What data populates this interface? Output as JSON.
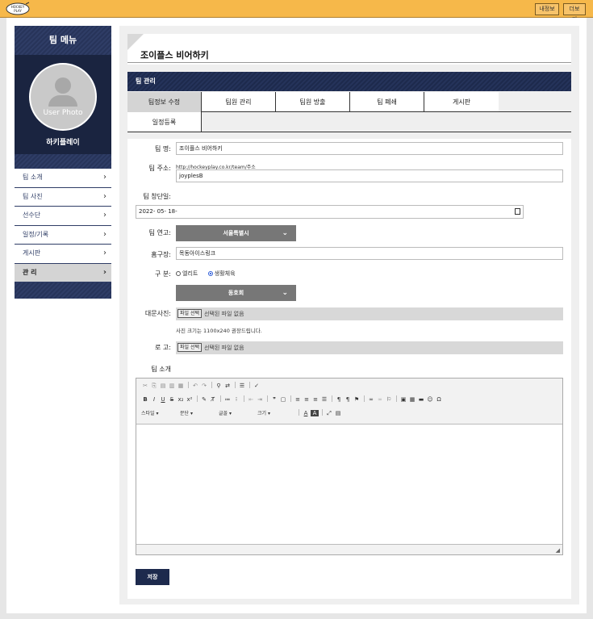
{
  "topbar": {
    "logo_text": "HOCKEY PLAY",
    "mypage_label": "내정보",
    "more_label": "더보기"
  },
  "sidebar": {
    "title": "팀 메뉴",
    "photo_placeholder": "User Photo",
    "team_nickname": "하키플레이",
    "items": [
      {
        "label": "팀 소개"
      },
      {
        "label": "팀 사진"
      },
      {
        "label": "선수단"
      },
      {
        "label": "일정/기록"
      },
      {
        "label": "게시판"
      },
      {
        "label": "관 리"
      }
    ],
    "active_item": "관 리"
  },
  "main": {
    "page_title": "조이플스 비어하키",
    "section_title": "팀 관리",
    "tabs": [
      {
        "label": "팀정보 수정"
      },
      {
        "label": "팀원 관리"
      },
      {
        "label": "팀원 방출"
      },
      {
        "label": "팀 폐쇄"
      },
      {
        "label": "게시판"
      },
      {
        "label": "일정등록"
      }
    ],
    "active_tab": "팀정보 수정"
  },
  "form": {
    "team_name_label": "팀 명:",
    "team_name_value": "조이플스 비어하키",
    "team_url_label": "팀 주소:",
    "team_url_prefix": "http://hockeyplay.co.kr/team/주소",
    "team_url_value": "joyplesB",
    "founded_label": "팀 창단일:",
    "founded_value": "2022- 05- 18-",
    "region_label": "팀 연고:",
    "region_value": "서울특별시",
    "home_rink_label": "홈구장:",
    "home_rink_value": "목동아이스링크",
    "category_label": "구 분:",
    "category_options": [
      {
        "label": "엘리트",
        "selected": false
      },
      {
        "label": "생활체육",
        "selected": true
      }
    ],
    "level_value": "동호회",
    "banner_label": "대문사진:",
    "file_button_label": "파일 선택",
    "no_file_text": "선택된 파일 없음",
    "banner_hint": "사진 크기는 1100x240 권장드립니다.",
    "logo_label": "로 고:",
    "intro_label": "팀 소개",
    "save_label": "저장"
  },
  "editor": {
    "style_combo": "스타일",
    "paragraph_combo": "문단",
    "font_combo": "글꼴",
    "size_combo": "크기",
    "toolbar_row1": [
      "cut-icon",
      "copy-icon",
      "paste-icon",
      "paste-text-icon",
      "paste-word-icon",
      "undo-icon",
      "redo-icon",
      "find-icon",
      "replace-icon",
      "select-all-icon",
      "spellcheck-icon"
    ],
    "toolbar_row2": [
      "bold-icon",
      "italic-icon",
      "underline-icon",
      "strike-icon",
      "subscript-icon",
      "superscript-icon",
      "copy-format-icon",
      "remove-format-icon",
      "numbered-list-icon",
      "bullet-list-icon",
      "outdent-icon",
      "indent-icon",
      "blockquote-icon",
      "div-icon",
      "align-left-icon",
      "align-center-icon",
      "align-right-icon",
      "justify-icon",
      "ltr-icon",
      "rtl-icon",
      "language-icon",
      "link-icon",
      "unlink-icon",
      "anchor-icon",
      "image-icon",
      "table-icon",
      "hr-icon",
      "smiley-icon",
      "special-char-icon"
    ]
  }
}
